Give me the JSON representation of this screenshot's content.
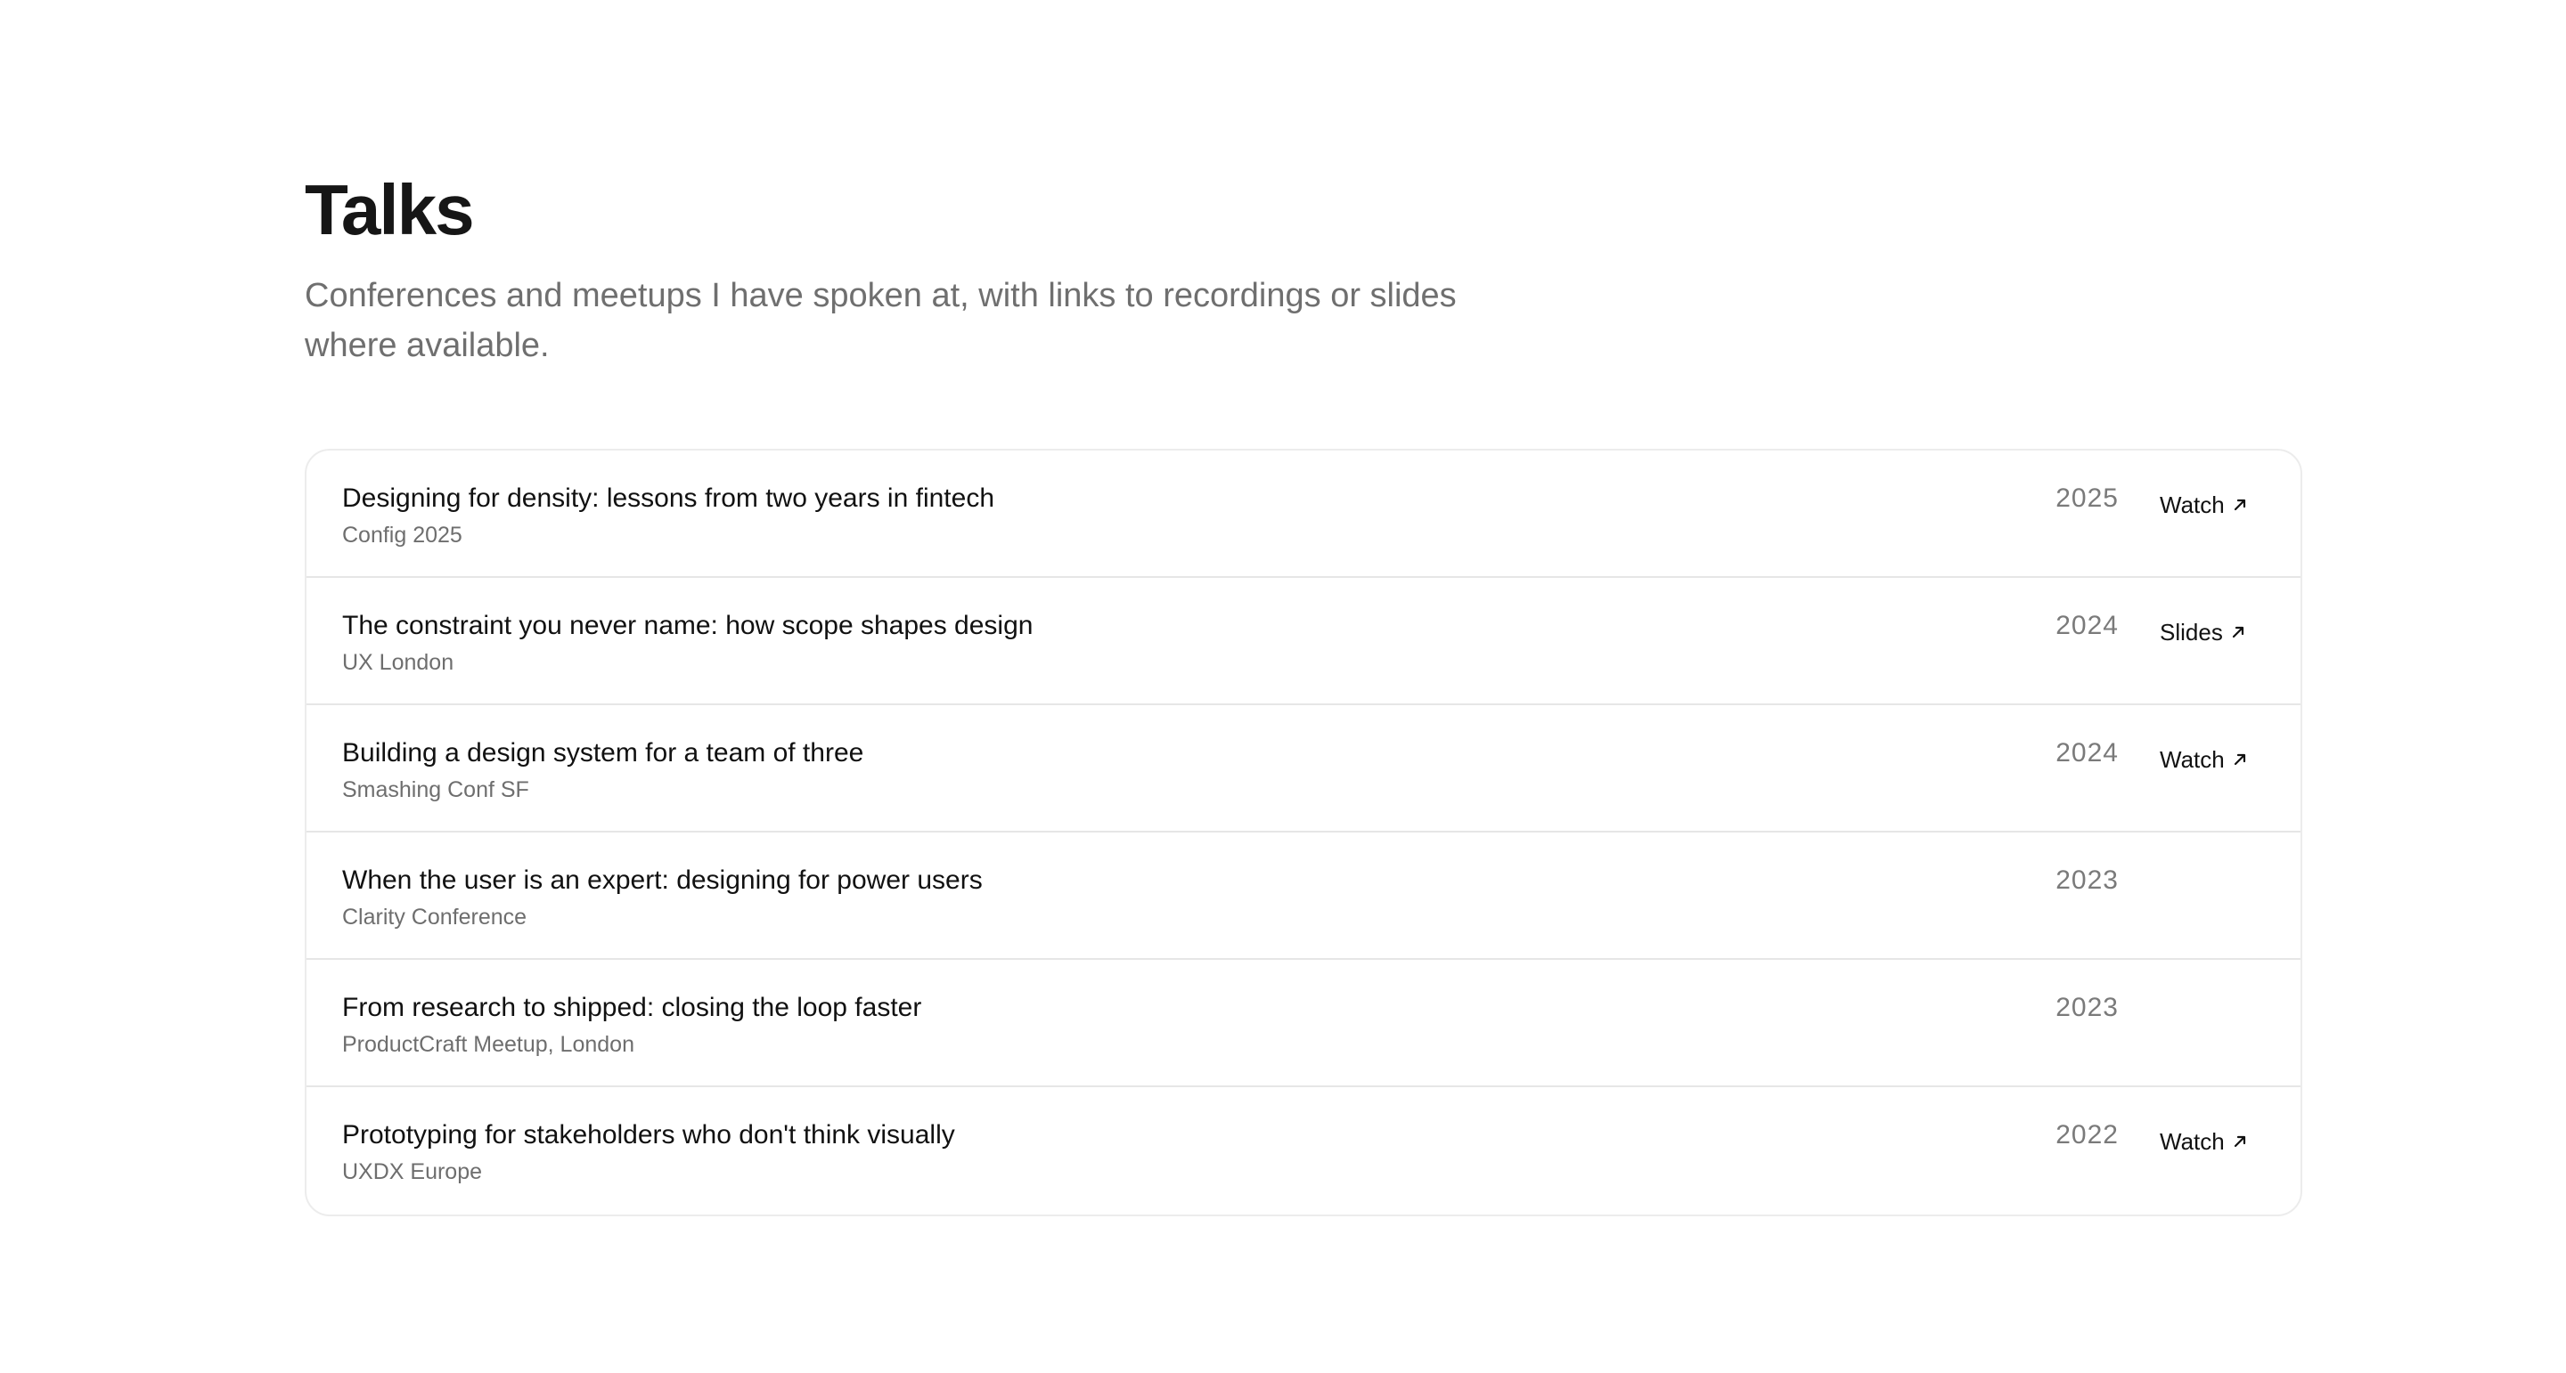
{
  "header": {
    "title": "Talks",
    "subtitle": "Conferences and meetups I have spoken at, with links to recordings or slides where available."
  },
  "talks": [
    {
      "title": "Designing for density: lessons from two years in fintech",
      "event": "Config 2025",
      "year": "2025",
      "link_label": "Watch",
      "link_icon": "arrow-up-right-icon"
    },
    {
      "title": "The constraint you never name: how scope shapes design",
      "event": "UX London",
      "year": "2024",
      "link_label": "Slides",
      "link_icon": "arrow-up-right-icon"
    },
    {
      "title": "Building a design system for a team of three",
      "event": "Smashing Conf SF",
      "year": "2024",
      "link_label": "Watch",
      "link_icon": "arrow-up-right-icon"
    },
    {
      "title": "When the user is an expert: designing for power users",
      "event": "Clarity Conference",
      "year": "2023"
    },
    {
      "title": "From research to shipped: closing the loop faster",
      "event": "ProductCraft Meetup, London",
      "year": "2023"
    },
    {
      "title": "Prototyping for stakeholders who don't think visually",
      "event": "UXDX Europe",
      "year": "2022",
      "link_label": "Watch",
      "link_icon": "arrow-up-right-icon"
    }
  ],
  "colors": {
    "title": "#161616",
    "subtitle": "#6f6f6f",
    "border": "#e6e6e6",
    "year": "#7a7a7a"
  }
}
